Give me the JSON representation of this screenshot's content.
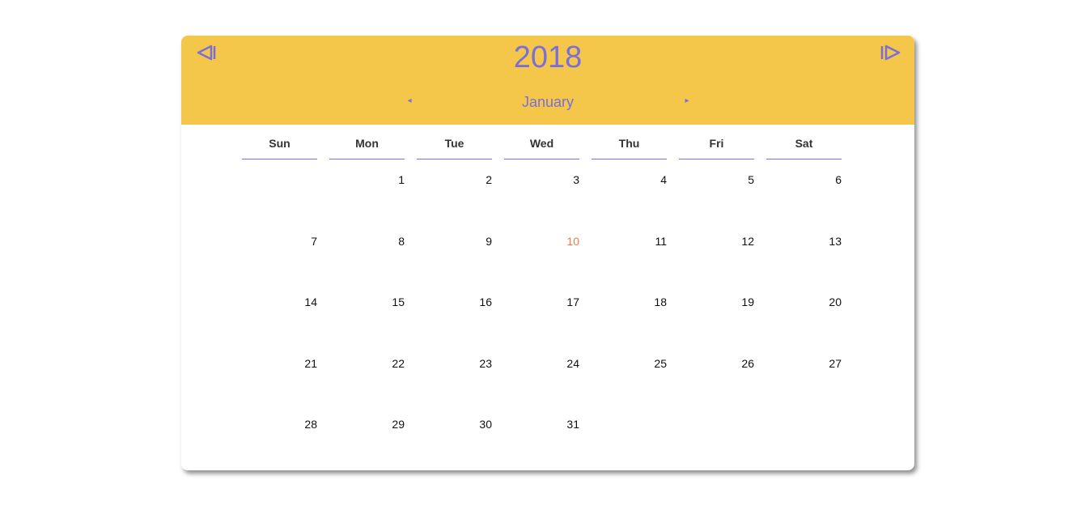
{
  "calendar": {
    "year": "2018",
    "month": "January",
    "year_prev_icon": "double-left-triangle-icon",
    "year_next_icon": "double-right-triangle-icon",
    "month_prev_glyph": "◂",
    "month_next_glyph": "▸",
    "weekdays": [
      "Sun",
      "Mon",
      "Tue",
      "Wed",
      "Thu",
      "Fri",
      "Sat"
    ],
    "weeks": [
      [
        "",
        "1",
        "2",
        "3",
        "4",
        "5",
        "6"
      ],
      [
        "7",
        "8",
        "9",
        "10",
        "11",
        "12",
        "13"
      ],
      [
        "14",
        "15",
        "16",
        "17",
        "18",
        "19",
        "20"
      ],
      [
        "21",
        "22",
        "23",
        "24",
        "25",
        "26",
        "27"
      ],
      [
        "28",
        "29",
        "30",
        "31",
        "",
        "",
        ""
      ]
    ],
    "today": "10"
  },
  "colors": {
    "header_bg": "#f4c74b",
    "accent": "#7b6fd6",
    "today": "#f07a52"
  }
}
